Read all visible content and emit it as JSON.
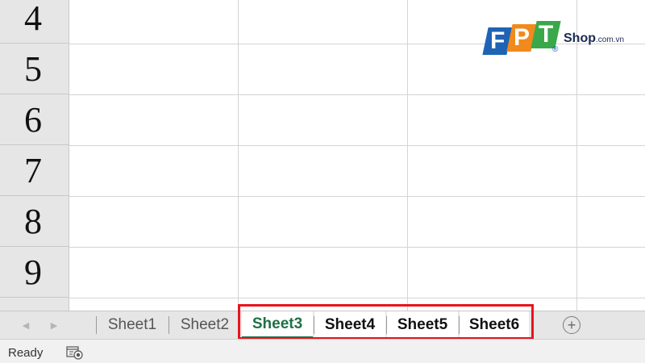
{
  "grid": {
    "row_headers": [
      "4",
      "5",
      "6",
      "7",
      "8",
      "9"
    ]
  },
  "logo": {
    "letters": [
      "F",
      "P",
      "T"
    ],
    "registered": "®",
    "shop": "Shop",
    "domain": ".com.vn",
    "colors": {
      "f": "#1f63b5",
      "p": "#f08a1c",
      "t": "#3aa84a"
    }
  },
  "tabbar": {
    "prev_icon": "scroll-left-icon",
    "next_icon": "scroll-right-icon",
    "tabs": [
      {
        "label": "Sheet1",
        "active": false
      },
      {
        "label": "Sheet2",
        "active": false
      },
      {
        "label": "Sheet3",
        "active": true
      },
      {
        "label": "Sheet4",
        "active": false
      },
      {
        "label": "Sheet5",
        "active": false
      },
      {
        "label": "Sheet6",
        "active": false
      }
    ],
    "add_icon": "plus-circle-icon",
    "highlight_color": "#e8141d",
    "active_color": "#1e7145"
  },
  "statusbar": {
    "status": "Ready",
    "icon": "macro-recording-icon"
  }
}
